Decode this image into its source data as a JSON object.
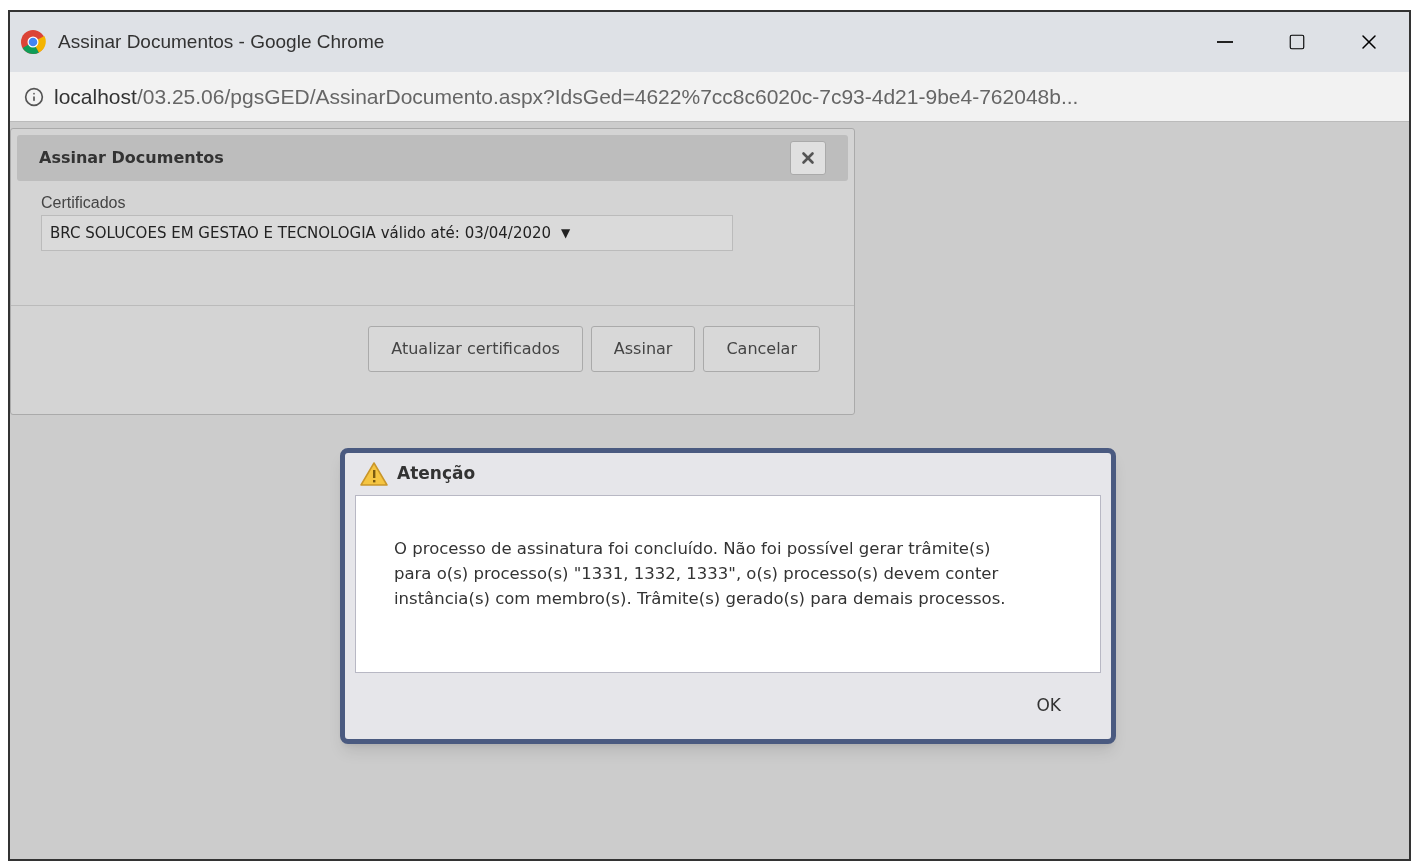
{
  "window": {
    "title": "Assinar Documentos - Google Chrome"
  },
  "address_bar": {
    "host": "localhost",
    "path": "/03.25.06/pgsGED/AssinarDocumento.aspx?IdsGed=4622%7cc8c6020c-7c93-4d21-9be4-762048b..."
  },
  "sign_dialog": {
    "title": "Assinar Documentos",
    "field_label": "Certificados",
    "certificate_value": "BRC SOLUCOES EM GESTAO E TECNOLOGIA válido até: 03/04/2020",
    "dropdown_glyph": "▼",
    "buttons": [
      "Atualizar certificados",
      "Assinar",
      "Cancelar"
    ]
  },
  "alert_dialog": {
    "title": "Atenção",
    "message": "O processo de assinatura foi concluído. Não foi possível gerar trâmite(s) para o(s) processo(s) \"1331, 1332, 1333\", o(s) processo(s) devem conter instância(s) com membro(s). Trâmite(s) gerado(s) para demais processos.",
    "button": "OK"
  }
}
